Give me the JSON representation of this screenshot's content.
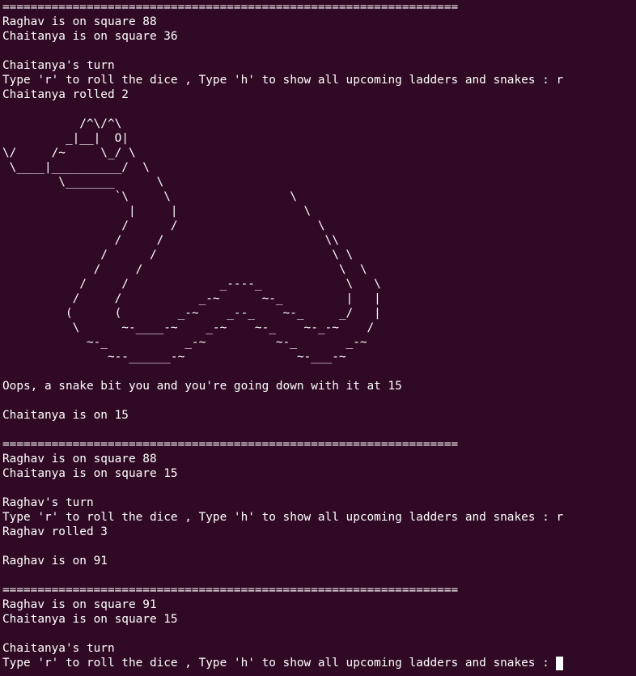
{
  "terminal": {
    "colors": {
      "background": "#300a24",
      "foreground": "#ffffff"
    },
    "lines": [
      "=================================================================",
      "Raghav is on square 88",
      "Chaitanya is on square 36",
      "",
      "Chaitanya's turn",
      "Type 'r' to roll the dice , Type 'h' to show all upcoming ladders and snakes : r",
      "Chaitanya rolled 2",
      "",
      "           /^\\/^\\",
      "         _|__|  O|",
      "\\/     /~     \\_/ \\",
      " \\____|__________/  \\",
      "        \\_______      \\",
      "                `\\     \\                 \\",
      "                  |     |                  \\",
      "                 /      /                    \\",
      "                /     /                       \\\\",
      "              /      /                         \\ \\",
      "             /     /                            \\  \\",
      "           /     /             _----_            \\   \\",
      "          /     /           _-~      ~-_         |   |",
      "         (      (        _-~    _--_    ~-_     _/   |",
      "          \\      ~-____-~    _-~    ~-_    ~-_-~    /",
      "            ~-_           _-~          ~-_       _-~",
      "               ~--______-~                ~-___-~",
      "",
      "Oops, a snake bit you and you're going down with it at 15",
      "",
      "Chaitanya is on 15",
      "",
      "=================================================================",
      "Raghav is on square 88",
      "Chaitanya is on square 15",
      "",
      "Raghav's turn",
      "Type 'r' to roll the dice , Type 'h' to show all upcoming ladders and snakes : r",
      "Raghav rolled 3",
      "",
      "Raghav is on 91",
      "",
      "=================================================================",
      "Raghav is on square 91",
      "Chaitanya is on square 15",
      "",
      "Chaitanya's turn"
    ],
    "prompt": "Type 'r' to roll the dice , Type 'h' to show all upcoming ladders and snakes : "
  }
}
